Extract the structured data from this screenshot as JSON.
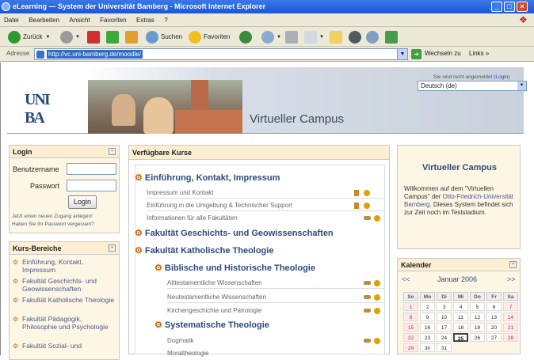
{
  "window": {
    "title": "eLearning — System der Universität Bamberg - Microsoft Internet Explorer"
  },
  "menu": [
    "Datei",
    "Bearbeiten",
    "Ansicht",
    "Favoriten",
    "Extras",
    "?"
  ],
  "toolbar": {
    "back": "Zurück",
    "search": "Suchen",
    "favorites": "Favoriten"
  },
  "address": {
    "label": "Adresse",
    "url": "http://vc.uni-bamberg.de/moodle/",
    "go": "Wechseln zu",
    "links": "Links"
  },
  "header": {
    "site_title": "Virtueller Campus",
    "login_state": "Sie sind nicht angemeldet",
    "login_link": "(Login)",
    "language": "Deutsch (de)"
  },
  "login": {
    "title": "Login",
    "user_label": "Benutzername",
    "pass_label": "Passwort",
    "button": "Login",
    "new_account": "Jetzt einen neuen Zugang anlegen!",
    "forgot": "Haben Sie Ihr Passwort vergessen?"
  },
  "kursbereiche": {
    "title": "Kurs-Bereiche",
    "items": [
      "Einführung, Kontakt, Impressum",
      "Fakultät Geschichts- und Geowissenschaften",
      "Fakultät Katholische Theologie",
      "Fakultät Pädagogik, Philosophie und Psychologie",
      "Fakultät Sozial- und"
    ]
  },
  "courses": {
    "title": "Verfügbare Kurse",
    "cat1": "Einführung, Kontakt, Impressum",
    "cat1_items": [
      "Impressum und Kontakt",
      "Einführung in die Umgebung & Technischer Support",
      "Informationen für alle Fakultäten"
    ],
    "cat2": "Fakultät Geschichts- und Geowissenschaften",
    "cat3": "Fakultät Katholische Theologie",
    "sub1": "Biblische und Historische Theologie",
    "sub1_items": [
      "Alttestamentliche Wissenschaften",
      "Neutestamentliche Wissenschaften",
      "Kirchengeschichte und Patrologie"
    ],
    "sub2": "Systematische Theologie",
    "sub2_items": [
      "Dogmatik",
      "Moraltheologie"
    ]
  },
  "vc": {
    "title": "Virtueller Campus",
    "text1": "Willkommen auf dem \"Virtuellen Campus\" der ",
    "text_link": "Otto-Friedrich-Universität Bamberg",
    "text2": ". Dieses System befindet sich zur Zeit noch im Teststadium."
  },
  "calendar": {
    "title": "Kalender",
    "prev": "<<",
    "next": ">>",
    "month": "Januar 2006",
    "days": [
      "So",
      "Mo",
      "Di",
      "Mi",
      "Do",
      "Fr",
      "Sa"
    ],
    "dates": [
      "1",
      "2",
      "3",
      "4",
      "5",
      "6",
      "7",
      "8",
      "9",
      "10",
      "11",
      "12",
      "13",
      "14",
      "15",
      "16",
      "17",
      "18",
      "19",
      "20",
      "21",
      "22",
      "23",
      "24",
      "25",
      "26",
      "27",
      "28",
      "29",
      "30",
      "31"
    ],
    "today": "25"
  }
}
